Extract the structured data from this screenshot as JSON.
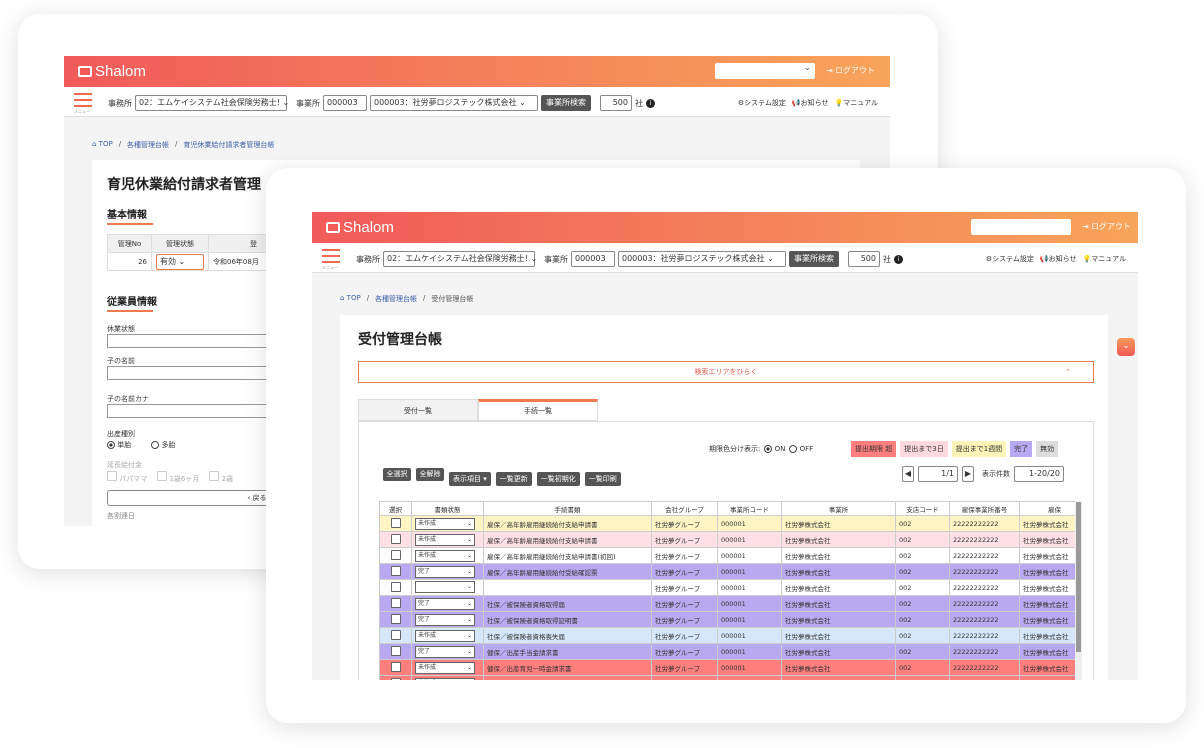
{
  "app": {
    "logo": "Shalom",
    "logout": "ログアウト",
    "menu_caption": "メニュー"
  },
  "subbar": {
    "office_label": "事務所",
    "office_value": "02：エムケイシステム社会保険労務士!",
    "site_label": "事業所",
    "site_code": "000003",
    "site_value": "000003：社労夢ロジステック株式会社",
    "search_btn": "事業所検索",
    "count": "500",
    "count_unit": "社",
    "system": "システム設定",
    "notice": "お知らせ",
    "manual": "マニュアル"
  },
  "back": {
    "crumbs": [
      "TOP",
      "各種管理台帳",
      "育児休業給付請求者管理台帳"
    ],
    "title": "育児休業給付請求者管理",
    "basic": "基本情報",
    "th_no": "管理No",
    "th_status": "管理状態",
    "th_reg": "登",
    "no": "26",
    "status": "有効",
    "date": "令和06年08月",
    "emp": "従業員情報",
    "leave": "休業状態",
    "child": "子の名前",
    "child_kana": "子の名前カナ",
    "birth": "出産種別",
    "single": "単胎",
    "multi": "多胎",
    "benefit": "延長給付金",
    "papa": "パパママ",
    "one_half": "1歳6ヶ月",
    "two": "2歳",
    "back_btn": "戻る",
    "day": "各割連日"
  },
  "front": {
    "crumbs": [
      "TOP",
      "各種管理台帳",
      "受付管理台帳"
    ],
    "title": "受付管理台帳",
    "search_toggle": "検索エリアをひらく",
    "tabs": [
      "受付一覧",
      "手続一覧"
    ],
    "period_label": "期限色分け表示:",
    "on": "ON",
    "off": "OFF",
    "legend": [
      "提出期限 超",
      "提出まで3日",
      "提出まで1週間",
      "完了",
      "無効"
    ],
    "legend_colors": [
      "#ff7f7f",
      "#ffd9e0",
      "#fff4b8",
      "#b7a8f2",
      "#dddddd"
    ],
    "select_all": "全選択",
    "deselect_all": "全解除",
    "display_items": "表示項目",
    "refresh": "一覧更新",
    "reset": "一覧初期化",
    "print": "一覧印刷",
    "page": "1/1",
    "count_label": "表示件数",
    "count_value": "1-20/20",
    "columns": [
      "選択",
      "書類状態",
      "手続書類",
      "会社グループ",
      "事業所コード",
      "事業所",
      "支店コード",
      "雇保事業所番号",
      "雇保"
    ],
    "rows": [
      {
        "status": "未作成",
        "doc": "雇保／高年齢雇用継続給付支給申請書",
        "group": "社労夢グループ",
        "code": "000001",
        "office": "社労夢株式会社",
        "branch": "002",
        "num": "22222222222",
        "emp": "社労夢株式会社",
        "color": "#fff4c4"
      },
      {
        "status": "未作成",
        "doc": "雇保／高年齢雇用継続給付支給申請書",
        "group": "社労夢グループ",
        "code": "000001",
        "office": "社労夢株式会社",
        "branch": "002",
        "num": "22222222222",
        "emp": "社労夢株式会社",
        "color": "#ffe0e6"
      },
      {
        "status": "未作成",
        "doc": "雇保／高年齢雇用継続給付支給申請書(初回)",
        "group": "社労夢グループ",
        "code": "000001",
        "office": "社労夢株式会社",
        "branch": "002",
        "num": "22222222222",
        "emp": "社労夢株式会社",
        "color": "#ffffff"
      },
      {
        "status": "完了",
        "doc": "雇保／高年齢雇用継続給付受給確認票",
        "group": "社労夢グループ",
        "code": "000001",
        "office": "社労夢株式会社",
        "branch": "002",
        "num": "22222222222",
        "emp": "社労夢株式会社",
        "color": "#b9a9f0"
      },
      {
        "status": "",
        "doc": "",
        "group": "社労夢グループ",
        "code": "000001",
        "office": "社労夢株式会社",
        "branch": "002",
        "num": "22222222222",
        "emp": "社労夢株式会社",
        "color": "#ffffff"
      },
      {
        "status": "完了",
        "doc": "社保／被保険者資格取得届",
        "group": "社労夢グループ",
        "code": "000001",
        "office": "社労夢株式会社",
        "branch": "002",
        "num": "22222222222",
        "emp": "社労夢株式会社",
        "color": "#b9a9f0"
      },
      {
        "status": "完了",
        "doc": "社保／被保険者資格取得証明書",
        "group": "社労夢グループ",
        "code": "000001",
        "office": "社労夢株式会社",
        "branch": "002",
        "num": "22222222222",
        "emp": "社労夢株式会社",
        "color": "#b9a9f0"
      },
      {
        "status": "未作成",
        "doc": "社保／被保険者資格喪失届",
        "group": "社労夢グループ",
        "code": "000001",
        "office": "社労夢株式会社",
        "branch": "002",
        "num": "22222222222",
        "emp": "社労夢株式会社",
        "color": "#d6e6fb"
      },
      {
        "status": "完了",
        "doc": "健保／出産手当金請求書",
        "group": "社労夢グループ",
        "code": "000001",
        "office": "社労夢株式会社",
        "branch": "002",
        "num": "22222222222",
        "emp": "社労夢株式会社",
        "color": "#b9a9f0"
      },
      {
        "status": "未作成",
        "doc": "健保／出産育児一時金請求書",
        "group": "社労夢グループ",
        "code": "000001",
        "office": "社労夢株式会社",
        "branch": "002",
        "num": "22222222222",
        "emp": "社労夢株式会社",
        "color": "#ff7f7f"
      },
      {
        "status": "未作成",
        "doc": "健保／被扶養者(異動)届",
        "group": "社労夢グループ",
        "code": "000001",
        "office": "社労夢株式会社",
        "branch": "002",
        "num": "22222222222",
        "emp": "社労夢株式会社",
        "color": "#ff7f7f"
      }
    ]
  }
}
